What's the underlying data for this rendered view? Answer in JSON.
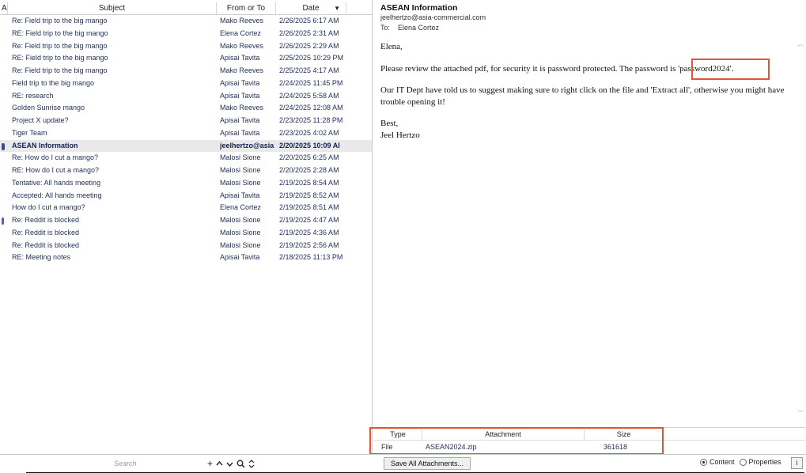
{
  "list": {
    "columns": {
      "flag": "A",
      "subject": "Subject",
      "from": "From or To",
      "date": "Date"
    },
    "rows": [
      {
        "subject": "Re: Field trip to the big mango",
        "from": "Mako Reeves",
        "date": "2/26/2025 6:17 AM"
      },
      {
        "subject": "RE: Field trip to the big mango",
        "from": "Elena Cortez",
        "date": "2/26/2025 2:31 AM"
      },
      {
        "subject": "Re: Field trip to the big mango",
        "from": "Mako Reeves",
        "date": "2/26/2025 2:29 AM"
      },
      {
        "subject": "RE: Field trip to the big mango",
        "from": "Apisai Tavita",
        "date": "2/25/2025 10:29 PM"
      },
      {
        "subject": "Re: Field trip to the big mango",
        "from": "Mako Reeves",
        "date": "2/25/2025 4:17 AM"
      },
      {
        "subject": "Field trip to the big mango",
        "from": "Apisai Tavita",
        "date": "2/24/2025 11:45 PM"
      },
      {
        "subject": "RE: research",
        "from": "Apisai Tavita",
        "date": "2/24/2025 5:58 AM"
      },
      {
        "subject": "Golden Sunrise mango",
        "from": "Mako Reeves",
        "date": "2/24/2025 12:08 AM"
      },
      {
        "subject": "Project X update?",
        "from": "Apisai Tavita",
        "date": "2/23/2025 11:28 PM"
      },
      {
        "subject": "Tiger Team",
        "from": "Apisai Tavita",
        "date": "2/23/2025 4:02 AM"
      },
      {
        "subject": "ASEAN Information",
        "from": "jeelhertzo@asia",
        "date": "2/20/2025 10:09 AI"
      },
      {
        "subject": "Re: How do I cut a mango?",
        "from": "Malosi Sione",
        "date": "2/20/2025 6:25 AM"
      },
      {
        "subject": "RE: How do I cut a mango?",
        "from": "Malosi Sione",
        "date": "2/20/2025 2:28 AM"
      },
      {
        "subject": "Tentative: All hands meeting",
        "from": "Malosi Sione",
        "date": "2/19/2025 8:54 AM"
      },
      {
        "subject": "Accepted: All hands meeting",
        "from": "Apisai Tavita",
        "date": "2/19/2025 8:52 AM"
      },
      {
        "subject": "How do I cut a mango?",
        "from": "Elena Cortez",
        "date": "2/19/2025 8:51 AM"
      },
      {
        "subject": "Re: Reddit is blocked",
        "from": "Malosi Sione",
        "date": "2/19/2025 4:47 AM"
      },
      {
        "subject": "Re: Reddit is blocked",
        "from": "Malosi Sione",
        "date": "2/19/2025 4:36 AM"
      },
      {
        "subject": "Re: Reddit is blocked",
        "from": "Malosi Sione",
        "date": "2/19/2025 2:56 AM"
      },
      {
        "subject": "RE: Meeting notes",
        "from": "Apisai Tavita",
        "date": "2/18/2025 11:13 PM"
      }
    ]
  },
  "message": {
    "subject": "ASEAN Information",
    "from": "jeelhertzo@asia-commercial.com",
    "to_label": "To:",
    "to": "Elena Cortez",
    "greeting": "Elena,",
    "para1_before": "Please review the attached pdf, for security it is password protected. The password is ",
    "password": "'password2024'",
    "para1_after": ".",
    "para2": "Our IT Dept have told us to suggest making sure to right click on the file and 'Extract all', otherwise you might have trouble opening it!",
    "closing": "Best,",
    "signature": "Jeel Hertzo"
  },
  "attachments": {
    "columns": {
      "type": "Type",
      "name": "Attachment",
      "size": "Size"
    },
    "items": [
      {
        "type": "File",
        "name": "ASEAN2024.zip",
        "size": "361618"
      }
    ]
  },
  "toolbar": {
    "search_placeholder": "Search",
    "add_icon": "+",
    "up_icon": "^",
    "down_icon": "v",
    "find_icon": "magnifier",
    "updown_icon": "updown",
    "save_all_label": "Save All Attachments...",
    "content_label": "Content",
    "properties_label": "Properties",
    "info_label": "i"
  },
  "colors": {
    "highlight": "#e05533",
    "selected_row": "#e9e9ec",
    "text": "#1f2d5a"
  }
}
